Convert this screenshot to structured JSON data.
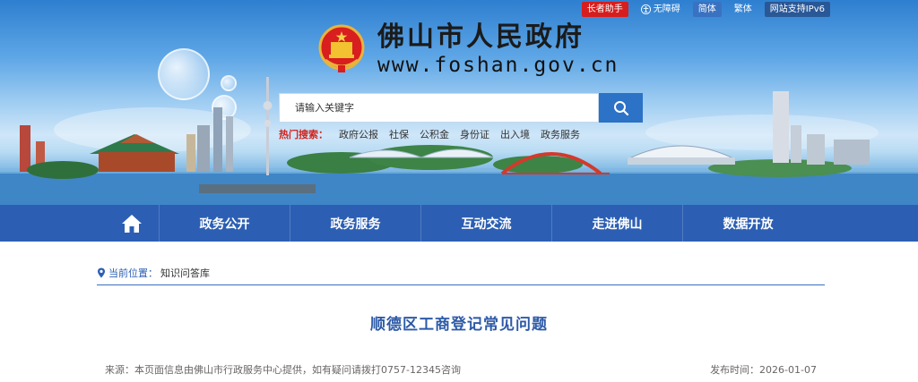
{
  "topbar": {
    "elder": "长者助手",
    "accessible": "无障碍",
    "simplified": "简体",
    "traditional": "繁体",
    "ipv6": "网站支持IPv6"
  },
  "logo": {
    "title": "佛山市人民政府",
    "url": "www.foshan.gov.cn"
  },
  "search": {
    "placeholder": "请输入关键字"
  },
  "hot": {
    "label": "热门搜索：",
    "items": [
      "政府公报",
      "社保",
      "公积金",
      "身份证",
      "出入境",
      "政务服务"
    ]
  },
  "nav": {
    "items": [
      "政务公开",
      "政务服务",
      "互动交流",
      "走进佛山",
      "数据开放"
    ]
  },
  "breadcrumb": {
    "label": "当前位置：",
    "current": "知识问答库"
  },
  "article": {
    "title": "顺德区工商登记常见问题",
    "source": "来源：本页面信息由佛山市行政服务中心提供，如有疑问请拨打0757-12345咨询",
    "date": "发布时间：2026-01-07"
  },
  "colors": {
    "nav_bg": "#2c5fb3",
    "title": "#2d5aa8",
    "search_btn": "#2c72c6",
    "elder_badge": "#d61e1e"
  }
}
